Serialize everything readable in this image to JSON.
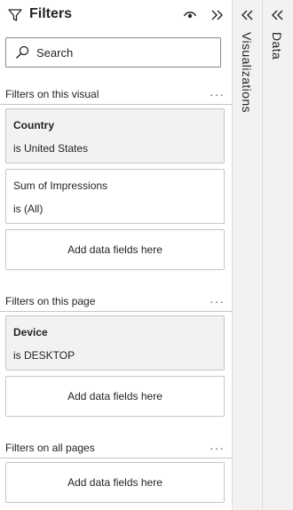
{
  "filters_pane": {
    "title": "Filters",
    "search": {
      "placeholder": "Search",
      "value": ""
    },
    "sections": [
      {
        "label": "Filters on this visual",
        "more": "···",
        "cards": [
          {
            "name": "Country",
            "condition": "is United States",
            "active": true
          },
          {
            "name": "Sum of Impressions",
            "condition": "is (All)",
            "active": false
          }
        ],
        "dropzone": "Add data fields here"
      },
      {
        "label": "Filters on this page",
        "more": "···",
        "cards": [
          {
            "name": "Device",
            "condition": "is DESKTOP",
            "active": true
          }
        ],
        "dropzone": "Add data fields here"
      },
      {
        "label": "Filters on all pages",
        "more": "···",
        "cards": [],
        "dropzone": "Add data fields here"
      }
    ]
  },
  "visualizations_pane": {
    "label": "Visualizations",
    "icon": "expand-chevrons-icon"
  },
  "data_pane": {
    "label": "Data",
    "icon": "expand-chevrons-icon"
  },
  "colors": {
    "active_card_bg": "#f3f2f1",
    "border": "#c8c6c4",
    "side_tab_bg": "#f3f2f1",
    "text": "#252423"
  }
}
